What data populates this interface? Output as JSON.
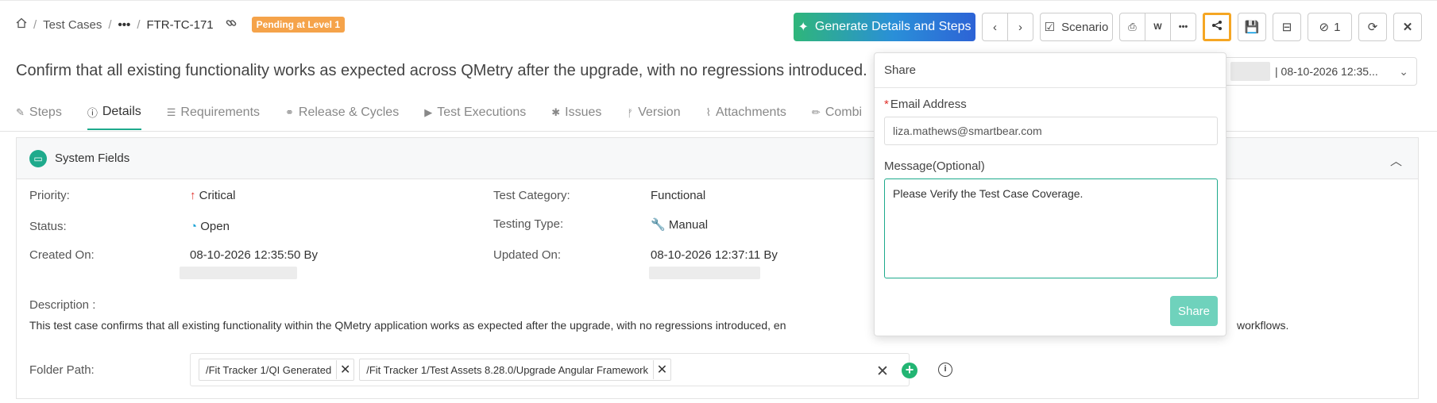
{
  "breadcrumb": {
    "home_icon": "home-icon",
    "sep": "/",
    "level1": "Test Cases",
    "ellipsis": "•••",
    "current": "FTR-TC-171",
    "status_badge": "Pending at Level 1",
    "badge_color": "#f5a34a"
  },
  "toolbar": {
    "generate_label": "Generate Details and Steps",
    "scenario_label": "Scenario",
    "watch_count": "1",
    "more": "•••",
    "close": "✕"
  },
  "page_title": "Confirm that all existing functionality works as expected across QMetry after the upgrade, with no regressions introduced.",
  "version_dropdown": {
    "text": "| 08-10-2026 12:35..."
  },
  "tabs": [
    {
      "label": "Steps",
      "icon": "edit-icon"
    },
    {
      "label": "Details",
      "icon": "info-icon"
    },
    {
      "label": "Requirements",
      "icon": "list-icon"
    },
    {
      "label": "Release & Cycles",
      "icon": "link-icon"
    },
    {
      "label": "Test Executions",
      "icon": "play-icon"
    },
    {
      "label": "Issues",
      "icon": "bug-icon"
    },
    {
      "label": "Version",
      "icon": "branch-icon"
    },
    {
      "label": "Attachments",
      "icon": "paperclip-icon"
    },
    {
      "label": "Combi",
      "icon": "pencil-icon"
    }
  ],
  "active_tab": "Details",
  "system_fields": {
    "title": "System Fields",
    "priority_label": "Priority:",
    "priority_value": "Critical",
    "status_label": "Status:",
    "status_value": "Open",
    "created_label": "Created On:",
    "created_value": "08-10-2026 12:35:50 By",
    "category_label": "Test Category:",
    "category_value": "Functional",
    "testing_type_label": "Testing Type:",
    "testing_type_value": "Manual",
    "updated_label": "Updated On:",
    "updated_value": "08-10-2026 12:37:11 By",
    "description_label": "Description :",
    "description_value": "This test case confirms that all existing functionality within the QMetry application works as expected after the upgrade, with no regressions introduced, en",
    "description_tail": "workflows.",
    "folder_label": "Folder Path:",
    "folders": [
      "/Fit Tracker 1/QI Generated",
      "/Fit Tracker 1/Test Assets 8.28.0/Upgrade Angular Framework"
    ]
  },
  "share_popover": {
    "title": "Share",
    "email_label": "Email Address",
    "email_value": "liza.mathews@smartbear.com",
    "message_label": "Message",
    "message_optional": "(Optional)",
    "message_value": "Please Verify the Test Case Coverage.",
    "share_button": "Share"
  },
  "colors": {
    "accent": "#1eaa8c",
    "highlight": "#f5a623",
    "required": "#e0302a"
  }
}
